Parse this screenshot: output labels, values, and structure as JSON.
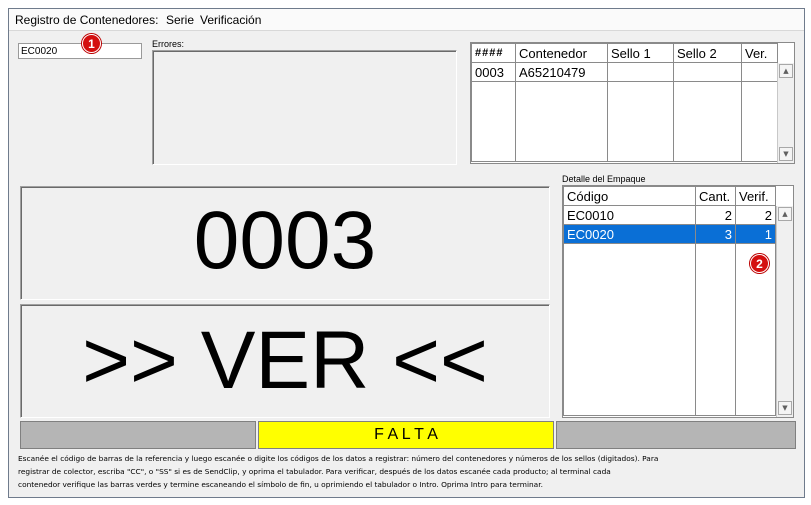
{
  "menu": {
    "items": [
      "Registro de Contenedores:",
      "Serie",
      "Verificación"
    ]
  },
  "code_input": {
    "value": "EC0020"
  },
  "badges": {
    "first": "1",
    "second": "2"
  },
  "errors": {
    "label": "Errores:"
  },
  "container_table": {
    "headers": [
      "####",
      "Contenedor",
      "Sello 1",
      "Sello 2",
      "Ver."
    ],
    "rows": [
      [
        "0003",
        "A65210479",
        "",
        "",
        ""
      ]
    ]
  },
  "detail": {
    "label": "Detalle del Empaque",
    "headers": [
      "Código",
      "Cant.",
      "Verif."
    ],
    "rows": [
      [
        "EC0010",
        "2",
        "2"
      ],
      [
        "EC0020",
        "3",
        "1"
      ]
    ],
    "selected_row": 1,
    "selected_color": "#0a6fd6"
  },
  "display": {
    "number": "0003",
    "message": ">> VER <<"
  },
  "status_bar": {
    "center_text": "F A L T A",
    "center_color": "#ffff00",
    "side_color": "#b5b5b5"
  },
  "instructions": {
    "line1": "Escanée el código de barras de la referencia y luego escanée o digite los códigos de los datos a registrar: número del contenedores y números de los sellos (digitados). Para",
    "line2": "registrar de colector, escriba \"CC\", o \"SS\" si es de SendClip, y oprima el tabulador. Para verificar, después de los datos escanée cada producto; al terminal cada",
    "line3": "contenedor verifique las barras verdes y termine escaneando el símbolo de fin, u oprimiendo el tabulador o Intro. Oprima Intro para terminar."
  }
}
